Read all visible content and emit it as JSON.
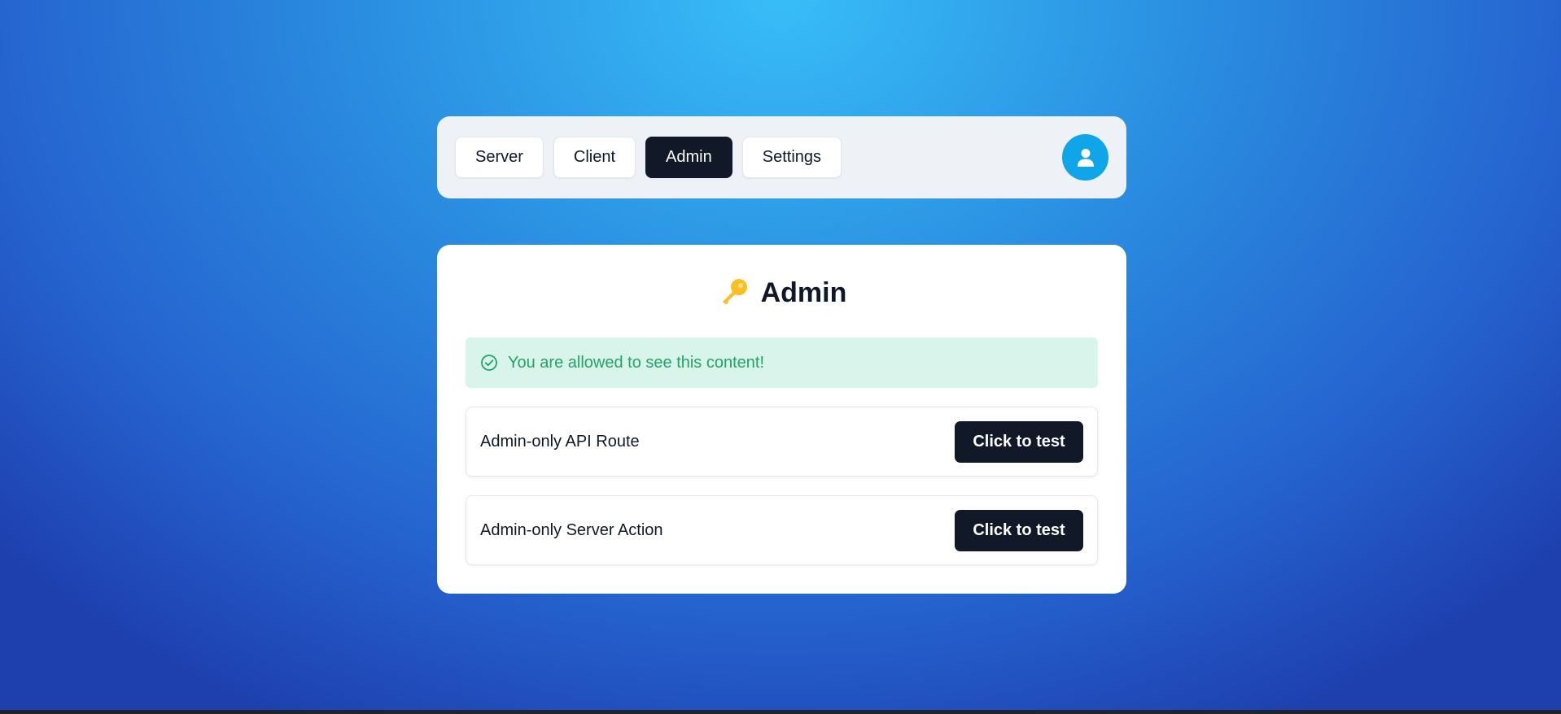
{
  "nav": {
    "tabs": [
      {
        "label": "Server"
      },
      {
        "label": "Client"
      },
      {
        "label": "Admin",
        "active": true
      },
      {
        "label": "Settings"
      }
    ],
    "avatar_icon": "user-icon"
  },
  "card": {
    "title_icon": "key-icon",
    "title": "Admin",
    "alert": {
      "icon": "check-circle-icon",
      "text": "You are allowed to see this content!"
    },
    "actions": [
      {
        "label": "Admin-only API Route",
        "button": "Click to test"
      },
      {
        "label": "Admin-only Server Action",
        "button": "Click to test"
      }
    ]
  },
  "colors": {
    "accent": "#0ea5e9",
    "dark": "#111827",
    "success_bg": "#d9f4ea",
    "success_text": "#22a36a",
    "key": "#fbbf24"
  }
}
